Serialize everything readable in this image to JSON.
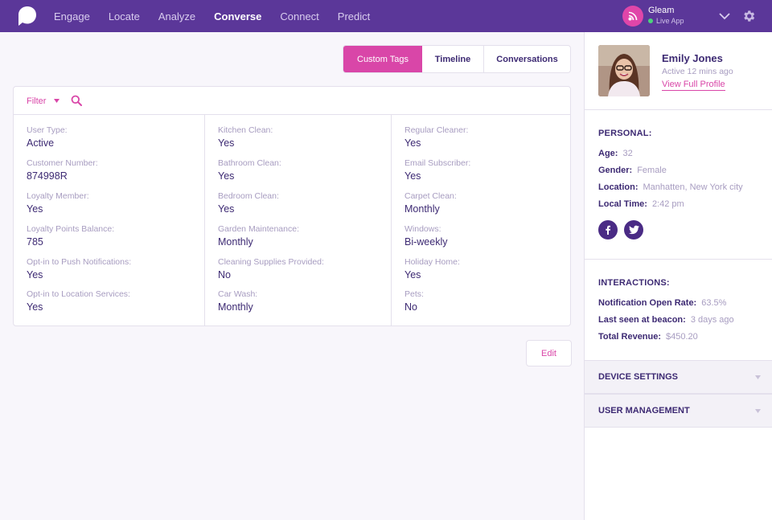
{
  "nav": {
    "items": [
      {
        "label": "Engage",
        "active": false
      },
      {
        "label": "Locate",
        "active": false
      },
      {
        "label": "Analyze",
        "active": false
      },
      {
        "label": "Converse",
        "active": true
      },
      {
        "label": "Connect",
        "active": false
      },
      {
        "label": "Predict",
        "active": false
      }
    ],
    "app_name": "Gleam",
    "app_status": "Live App"
  },
  "tabs": {
    "custom_tags": "Custom Tags",
    "timeline": "Timeline",
    "conversations": "Conversations"
  },
  "filter": {
    "label": "Filter"
  },
  "fields": {
    "col1": [
      {
        "label": "User Type:",
        "value": "Active"
      },
      {
        "label": "Customer Number:",
        "value": "874998R"
      },
      {
        "label": "Loyalty Member:",
        "value": "Yes"
      },
      {
        "label": "Loyalty Points Balance:",
        "value": "785"
      },
      {
        "label": "Opt-in to Push Notifications:",
        "value": "Yes"
      },
      {
        "label": "Opt-in to Location Services:",
        "value": "Yes"
      }
    ],
    "col2": [
      {
        "label": "Kitchen Clean:",
        "value": "Yes"
      },
      {
        "label": "Bathroom Clean:",
        "value": "Yes"
      },
      {
        "label": "Bedroom Clean:",
        "value": "Yes"
      },
      {
        "label": "Garden Maintenance:",
        "value": "Monthly"
      },
      {
        "label": "Cleaning Supplies Provided:",
        "value": "No"
      },
      {
        "label": "Car Wash:",
        "value": "Monthly"
      }
    ],
    "col3": [
      {
        "label": "Regular Cleaner:",
        "value": "Yes"
      },
      {
        "label": "Email Subscriber:",
        "value": "Yes"
      },
      {
        "label": "Carpet Clean:",
        "value": "Monthly"
      },
      {
        "label": "Windows:",
        "value": "Bi-weekly"
      },
      {
        "label": "Holiday Home:",
        "value": "Yes"
      },
      {
        "label": "Pets:",
        "value": "No"
      }
    ]
  },
  "edit_label": "Edit",
  "profile": {
    "name": "Emily Jones",
    "active": "Active 12 mins ago",
    "link": "View Full Profile"
  },
  "personal": {
    "title": "PERSONAL:",
    "rows": [
      {
        "k": "Age:",
        "v": "32"
      },
      {
        "k": "Gender:",
        "v": "Female"
      },
      {
        "k": "Location:",
        "v": "Manhatten, New York city"
      },
      {
        "k": "Local Time:",
        "v": "2:42 pm"
      }
    ]
  },
  "interactions": {
    "title": "INTERACTIONS:",
    "rows": [
      {
        "k": "Notification Open Rate:",
        "v": "63.5%"
      },
      {
        "k": "Last seen at beacon:",
        "v": "3 days ago"
      },
      {
        "k": "Total Revenue:",
        "v": "$450.20"
      }
    ]
  },
  "accordions": {
    "device": "DEVICE SETTINGS",
    "user_mgmt": "USER MANAGEMENT"
  },
  "icons": {
    "logo": "speech-bubble-logo",
    "app": "broadcast-icon",
    "facebook": "facebook-icon",
    "twitter": "twitter-icon"
  },
  "colors": {
    "topbar": "#5b3799",
    "accent": "#d946a8",
    "text": "#3d2a73",
    "muted": "#a79cc0"
  }
}
